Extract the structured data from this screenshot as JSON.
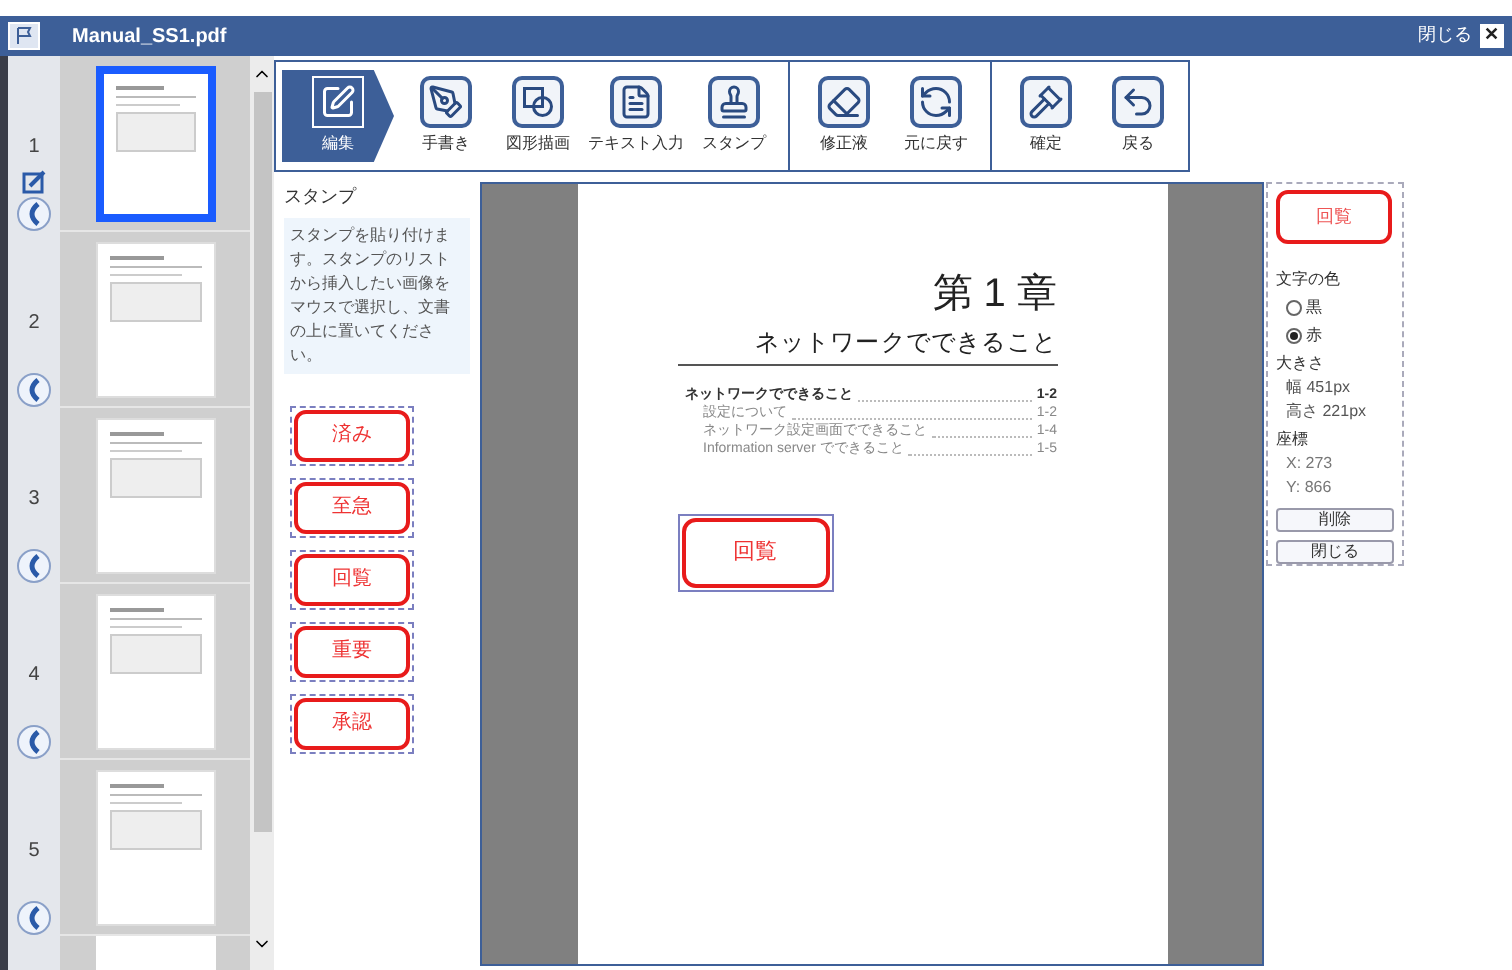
{
  "window": {
    "title": "Manual_SS1.pdf",
    "close_label": "閉じる",
    "close_glyph": "✕"
  },
  "pages": [
    {
      "number": "1",
      "selected": true,
      "edited": true
    },
    {
      "number": "2",
      "selected": false,
      "edited": false
    },
    {
      "number": "3",
      "selected": false,
      "edited": false
    },
    {
      "number": "4",
      "selected": false,
      "edited": false
    },
    {
      "number": "5",
      "selected": false,
      "edited": false
    }
  ],
  "toolbar": {
    "groups": [
      [
        {
          "label": "編集",
          "selected": true
        },
        {
          "label": "手書き",
          "selected": false
        },
        {
          "label": "図形描画",
          "selected": false
        },
        {
          "label": "テキスト入力",
          "selected": false
        },
        {
          "label": "スタンプ",
          "selected": false
        }
      ],
      [
        {
          "label": "修正液",
          "selected": false
        },
        {
          "label": "元に戻す",
          "selected": false
        }
      ],
      [
        {
          "label": "確定",
          "selected": false
        },
        {
          "label": "戻る",
          "selected": false
        }
      ]
    ]
  },
  "stamp_panel": {
    "title": "スタンプ",
    "help": "スタンプを貼り付けます。スタンプのリストから挿入したい画像をマウスで選択し、文書の上に置いてください。",
    "stamps": [
      "済み",
      "至急",
      "回覧",
      "重要",
      "承認"
    ]
  },
  "document": {
    "chapter": "第 1 章",
    "heading": "ネットワークでできること",
    "toc": [
      {
        "text": "ネットワークでできること",
        "page": "1-2",
        "kind": "heading"
      },
      {
        "text": "設定について",
        "page": "1-2",
        "kind": "entry"
      },
      {
        "text": "ネットワーク設定画面でできること",
        "page": "1-4",
        "kind": "entry"
      },
      {
        "text": "Information server でできること",
        "page": "1-5",
        "kind": "entry"
      }
    ],
    "placed_stamp": "回覧"
  },
  "properties": {
    "preview": "回覧",
    "color_label": "文字の色",
    "colors": [
      {
        "label": "黒",
        "selected": false
      },
      {
        "label": "赤",
        "selected": true
      }
    ],
    "size_label": "大きさ",
    "width": "幅 451px",
    "height": "高さ 221px",
    "pos_label": "座標",
    "x": "X: 273",
    "y": "Y: 866",
    "delete": "削除",
    "close": "閉じる"
  }
}
